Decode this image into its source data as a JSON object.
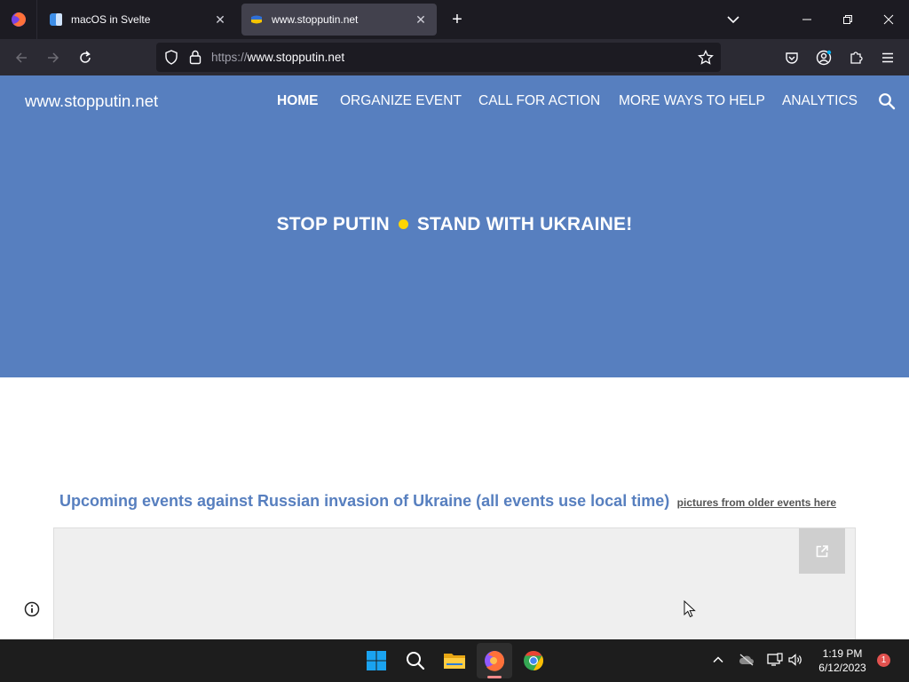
{
  "browser": {
    "tabs": [
      {
        "title": "macOS in Svelte",
        "active": false
      },
      {
        "title": "www.stopputin.net",
        "active": true
      }
    ],
    "url": {
      "scheme": "https://",
      "host": "www.stopputin.net"
    }
  },
  "site": {
    "logo": "www.stopputin.net",
    "nav": [
      "HOME",
      "ORGANIZE EVENT",
      "CALL FOR ACTION",
      "MORE WAYS TO HELP",
      "ANALYTICS"
    ],
    "hero": {
      "left": "STOP PUTIN",
      "right": "STAND WITH UKRAINE!"
    },
    "events_heading": "Upcoming events against Russian invasion of Ukraine (all events use local time)",
    "older_events_link": "pictures from older events here"
  },
  "taskbar": {
    "time": "1:19 PM",
    "date": "6/12/2023",
    "notifications": "1"
  },
  "colors": {
    "header_blue": "#577fbf",
    "hero_dot": "#ffd500"
  }
}
